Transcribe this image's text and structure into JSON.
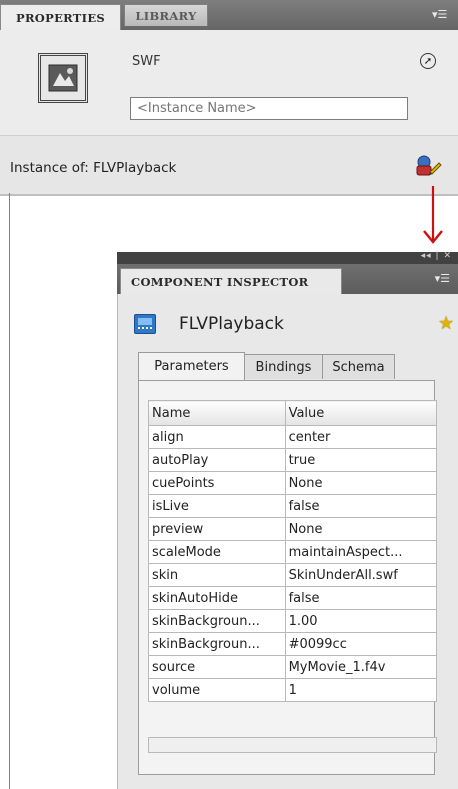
{
  "properties_panel": {
    "tabs": [
      {
        "label": "PROPERTIES",
        "active": true
      },
      {
        "label": "LIBRARY",
        "active": false
      }
    ],
    "menu_icon": "panel-menu-icon",
    "symbol_type": "SWF",
    "instance_name_placeholder": "<Instance Name>",
    "instance_of_label": "Instance of:",
    "instance_of_value": "FLVPlayback"
  },
  "component_inspector": {
    "title": "COMPONENT INSPECTOR",
    "component_name": "FLVPlayback",
    "tabs": [
      "Parameters",
      "Bindings",
      "Schema"
    ],
    "active_tab": "Parameters",
    "columns": [
      "Name",
      "Value"
    ],
    "parameters": [
      {
        "name": "align",
        "value": "center"
      },
      {
        "name": "autoPlay",
        "value": "true"
      },
      {
        "name": "cuePoints",
        "value": "None"
      },
      {
        "name": "isLive",
        "value": "false"
      },
      {
        "name": "preview",
        "value": "None"
      },
      {
        "name": "scaleMode",
        "value": "maintainAspect..."
      },
      {
        "name": "skin",
        "value": "SkinUnderAll.swf"
      },
      {
        "name": "skinAutoHide",
        "value": "false"
      },
      {
        "name": "skinBackgroun...",
        "value": "1.00"
      },
      {
        "name": "skinBackgroun...",
        "value": "#0099cc"
      },
      {
        "name": "source",
        "value": "MyMovie_1.f4v"
      },
      {
        "name": "volume",
        "value": "1"
      }
    ]
  },
  "colors": {
    "arrow": "#cc1111",
    "panel_border": "#5e86b8",
    "component_icon": "#2f78c6"
  }
}
